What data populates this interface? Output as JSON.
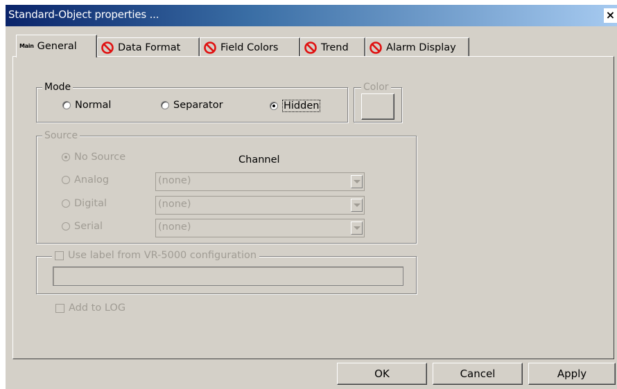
{
  "window": {
    "title": "Standard-Object properties ...",
    "close": "×"
  },
  "tabs": [
    {
      "label": "General",
      "icon_text": "Main",
      "active": true
    },
    {
      "label": "Data Format",
      "icon": "prohibited-icon"
    },
    {
      "label": "Field Colors",
      "icon": "prohibited-icon"
    },
    {
      "label": "Trend",
      "icon": "prohibited-icon"
    },
    {
      "label": "Alarm Display",
      "icon": "prohibited-icon"
    }
  ],
  "mode": {
    "label": "Mode",
    "options": [
      "Normal",
      "Separator",
      "Hidden"
    ],
    "selected": "Hidden"
  },
  "color": {
    "label": "Color"
  },
  "source": {
    "label": "Source",
    "channel_header": "Channel",
    "options": [
      "No Source",
      "Analog",
      "Digital",
      "Serial"
    ],
    "selected": "No Source",
    "channels": [
      "(none)",
      "(none)",
      "(none)"
    ]
  },
  "label_group": {
    "checkbox_label": "Use label from VR-5000 configuration",
    "value": ""
  },
  "log": {
    "checkbox_label": "Add to LOG"
  },
  "buttons": {
    "ok": "OK",
    "cancel": "Cancel",
    "apply": "Apply"
  },
  "colors": {
    "dialog_bg": "#d4d0c8",
    "title_start": "#0a246a",
    "title_end": "#a6caf0",
    "disabled_text": "#a09c94",
    "prohibited": "#e01010"
  }
}
